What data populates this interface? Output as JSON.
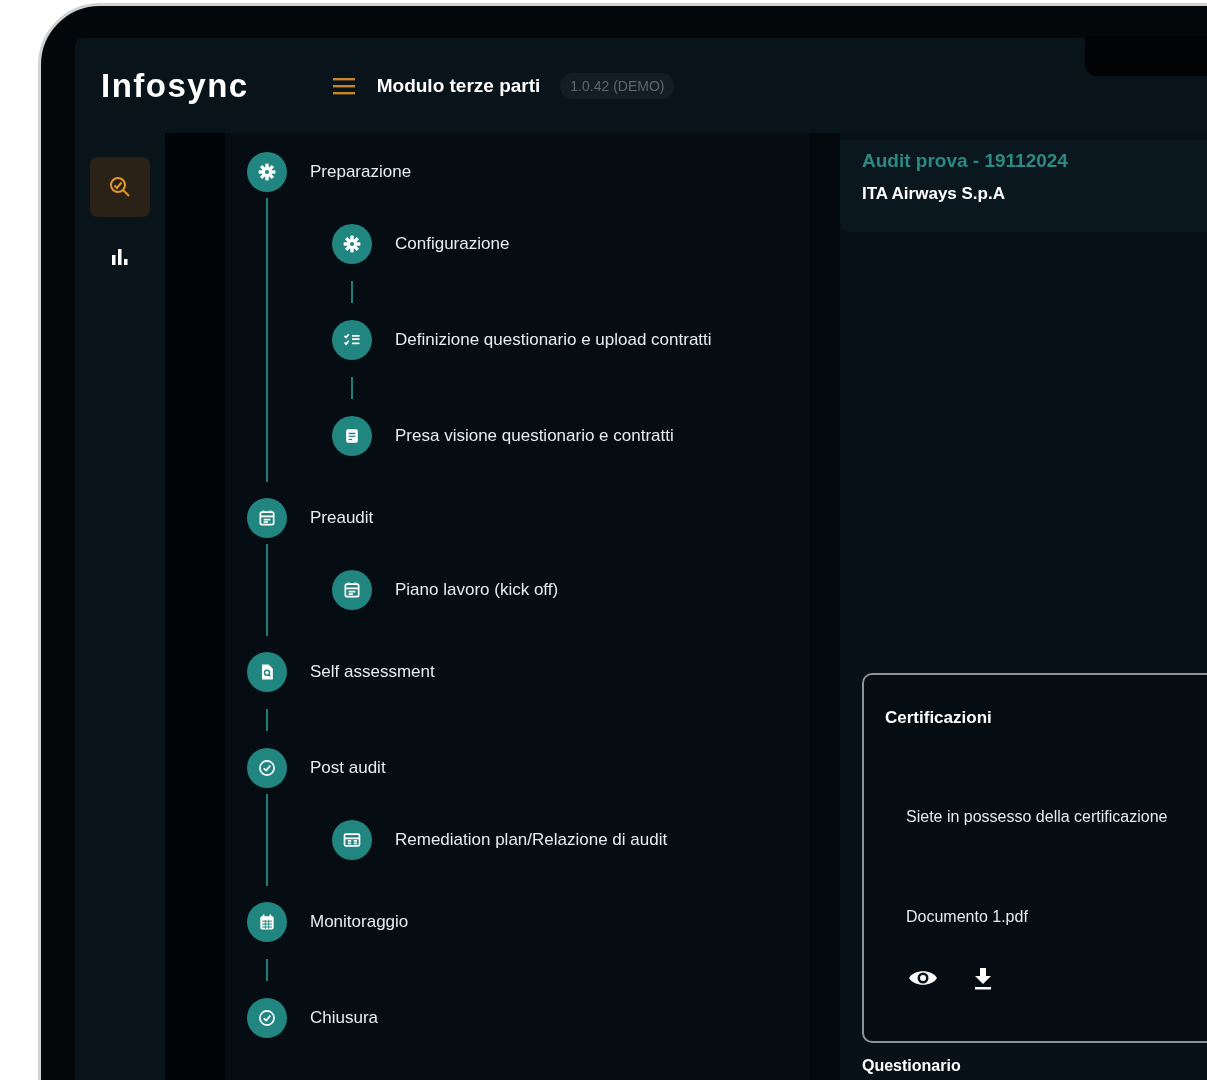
{
  "header": {
    "logo": "Infosync",
    "title": "Modulo terze parti",
    "version": "1.0.42 (DEMO)"
  },
  "rail": [
    {
      "kind": "audit",
      "selected": true
    },
    {
      "kind": "chart",
      "selected": false
    }
  ],
  "steps": [
    {
      "label": "Preparazione",
      "kind": "gear",
      "children": [
        {
          "label": "Configurazione",
          "kind": "gear"
        },
        {
          "label": "Definizione questionario e upload contratti",
          "kind": "checklist"
        },
        {
          "label": "Presa visione questionario e contratti",
          "kind": "document"
        }
      ]
    },
    {
      "label": "Preaudit",
      "kind": "calendar",
      "children": [
        {
          "label": "Piano lavoro (kick off)",
          "kind": "calendar"
        }
      ]
    },
    {
      "label": "Self assessment",
      "kind": "search"
    },
    {
      "label": "Post audit",
      "kind": "check",
      "children": [
        {
          "label": "Remediation plan/Relazione di audit",
          "kind": "report"
        }
      ]
    },
    {
      "label": "Monitoraggio",
      "kind": "grid"
    },
    {
      "label": "Chiusura",
      "kind": "check"
    }
  ],
  "audit": {
    "title": "Audit prova - 19112024",
    "company": "ITA Airways S.p.A"
  },
  "certifications": {
    "title": "Certificazioni",
    "question": "Siete in possesso della certificazione",
    "file": "Documento 1.pdf"
  },
  "next_section": "Questionario"
}
